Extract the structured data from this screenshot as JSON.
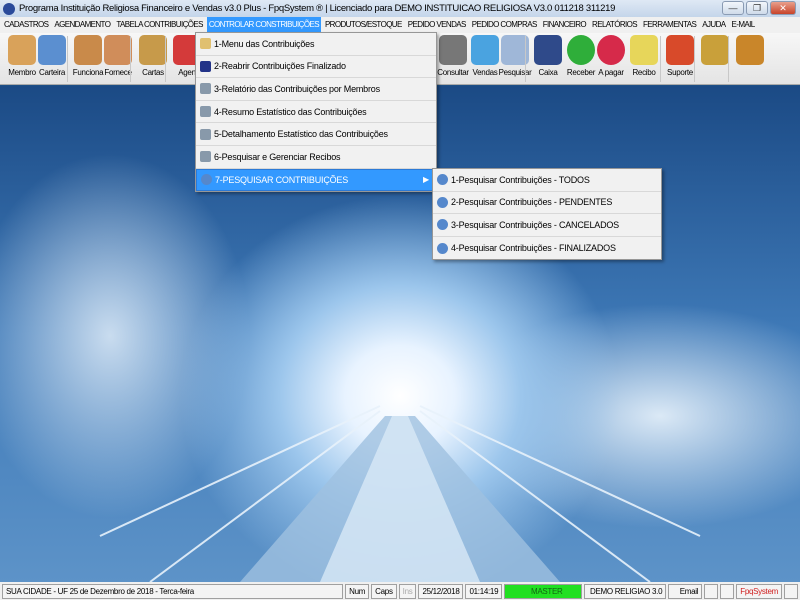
{
  "window": {
    "title": "Programa Instituição Religiosa Financeiro e Vendas v3.0 Plus - FpqSystem ® | Licenciado para  DEMO INSTITUICAO RELIGIOSA V3.0 011218 311219",
    "min": "—",
    "max": "❐",
    "close": "✕"
  },
  "menu": [
    "CADASTROS",
    "AGENDAMENTO",
    "TABELA CONTRIBUIÇÕES",
    "CONTROLAR CONSTRIBUIÇÕES",
    "PRODUTOS/ESTOQUE",
    "PEDIDO VENDAS",
    "PEDIDO COMPRAS",
    "FINANCEIRO",
    "RELATÓRIOS",
    "FERRAMENTAS",
    "AJUDA",
    "E-MAIL"
  ],
  "toolbar": [
    {
      "label": "Membro",
      "color": "#d9a25a"
    },
    {
      "label": "Carteira",
      "color": "#5b8fd0"
    },
    {
      "label": "Funciona",
      "color": "#c98a4a"
    },
    {
      "label": "Fornece",
      "color": "#d08d5a"
    },
    {
      "label": "Cartas",
      "color": "#c79a4a"
    },
    {
      "label": "Agen",
      "color": "#d43a3a"
    },
    {
      "label": "Consultar",
      "color": "#777777"
    },
    {
      "label": "Vendas",
      "color": "#4aa3e0"
    },
    {
      "label": "Pesquisar",
      "color": "#9fb7d8"
    },
    {
      "label": "Caixa",
      "color": "#2f4a8a"
    },
    {
      "label": "Receber",
      "color": "#2fae3a"
    },
    {
      "label": "A pagar",
      "color": "#d62a4a"
    },
    {
      "label": "Recibo",
      "color": "#e7d65a"
    },
    {
      "label": "Suporte",
      "color": "#d84a2a"
    },
    {
      "label": "",
      "color": "#c9a03a"
    },
    {
      "label": "",
      "color": "#c9862a"
    }
  ],
  "dropdown": [
    "1-Menu das Contribuições",
    "2-Reabrir Contribuições Finalizado",
    "3-Relatório das Contribuições por Membros",
    "4-Resumo Estatístico das Contribuições",
    "5-Detalhamento Estatístico das Contribuições",
    "6-Pesquisar e Gerenciar Recibos",
    "7-PESQUISAR CONTRIBUIÇÕES"
  ],
  "submenu": [
    "1-Pesquisar Contribuições - TODOS",
    "2-Pesquisar Contribuições - PENDENTES",
    "3-Pesquisar Contribuições - CANCELADOS",
    "4-Pesquisar Contribuições - FINALIZADOS"
  ],
  "status": {
    "location": "SUA CIDADE - UF 25 de Dezembro de 2018 - Terca-feira",
    "num": "Num",
    "caps": "Caps",
    "ins": "Ins",
    "date": "25/12/2018",
    "time": "01:14:19",
    "user": "MASTER",
    "db": "DEMO RELIGIAO 3.0",
    "email": "Email",
    "brand": "FpqSystem"
  }
}
